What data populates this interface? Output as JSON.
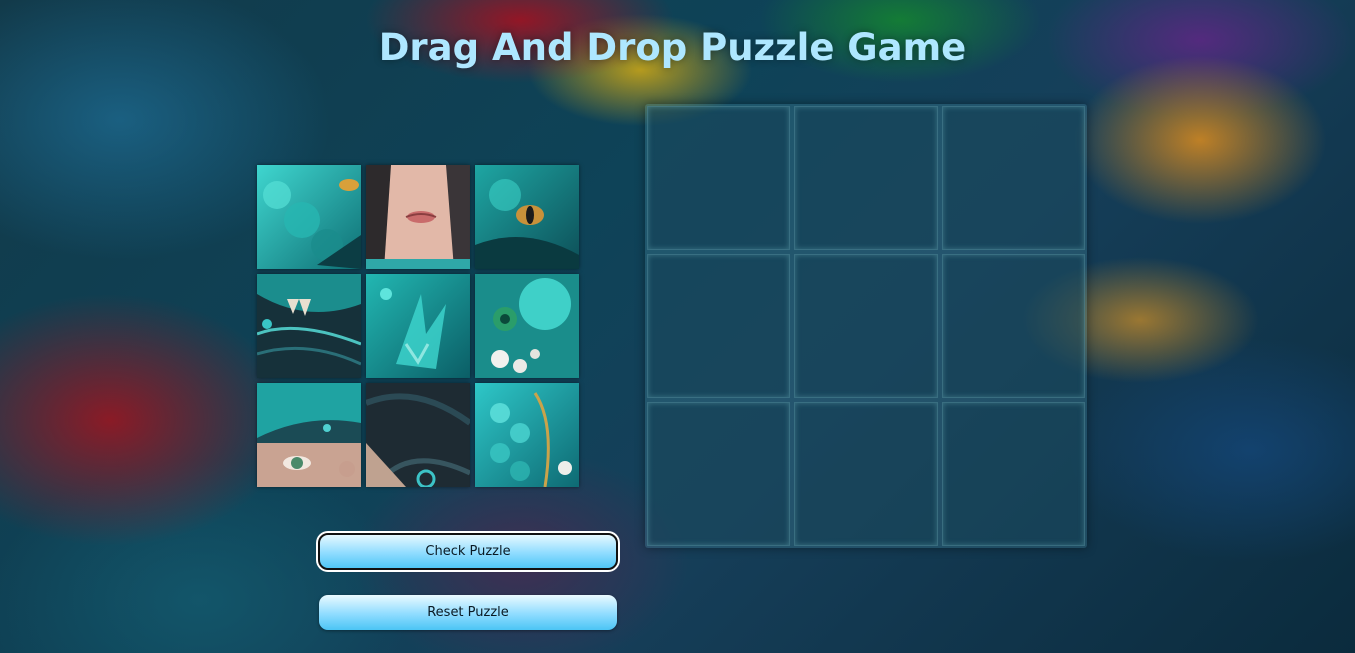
{
  "title": "Drag And Drop Puzzle Game",
  "buttons": {
    "check": "Check Puzzle",
    "reset": "Reset Puzzle"
  },
  "colors": {
    "title": "#aee7ff",
    "button_top": "#eafaff",
    "button_bottom": "#4cc5f5",
    "tile_teal": "#1fb3b0"
  },
  "pieces": [
    {
      "name": "puzzle-piece-1",
      "icon": "dragon-scales-eye"
    },
    {
      "name": "puzzle-piece-2",
      "icon": "girl-face-lips"
    },
    {
      "name": "puzzle-piece-3",
      "icon": "dragon-eye"
    },
    {
      "name": "puzzle-piece-4",
      "icon": "dragon-teeth-hair"
    },
    {
      "name": "puzzle-piece-5",
      "icon": "dragon-claw"
    },
    {
      "name": "puzzle-piece-6",
      "icon": "dragon-flowers"
    },
    {
      "name": "puzzle-piece-7",
      "icon": "girl-eye"
    },
    {
      "name": "puzzle-piece-8",
      "icon": "girl-hair"
    },
    {
      "name": "puzzle-piece-9",
      "icon": "dragon-scales-flowers"
    }
  ],
  "board": {
    "rows": 3,
    "cols": 3,
    "filled": 0
  }
}
